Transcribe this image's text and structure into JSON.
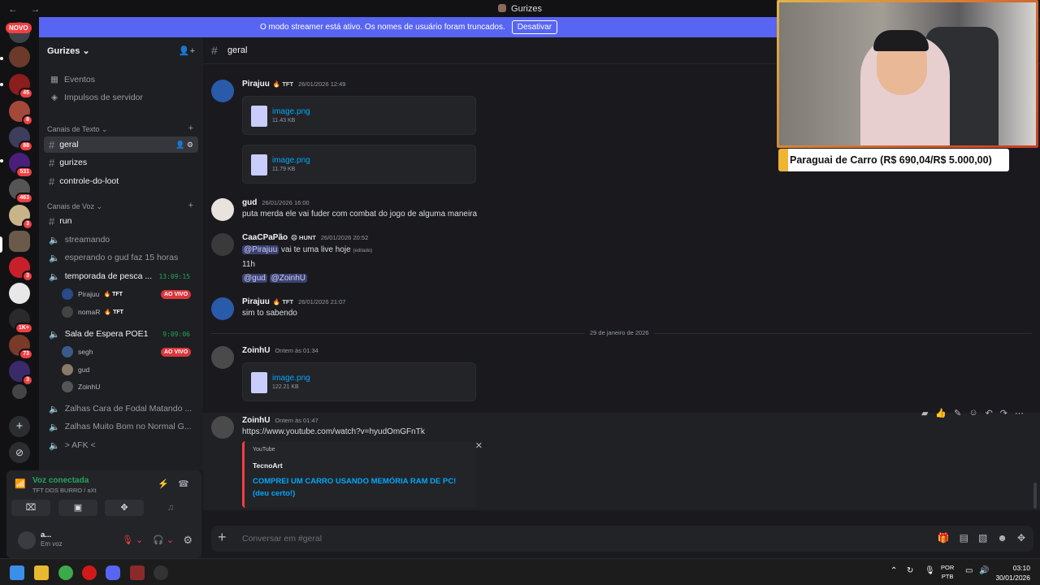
{
  "window": {
    "title": "Gurizes",
    "nav": "← →"
  },
  "banner": {
    "text": "O modo streamer está ativo. Os nomes de usuário foram truncados.",
    "button": "Desativar"
  },
  "servers": {
    "novo": "NOVO",
    "badges": [
      "45",
      "8",
      "88",
      "531",
      "463",
      "3",
      "3",
      "1K+",
      "73",
      "3"
    ],
    "add_icon": "+",
    "explore_icon": "⊘"
  },
  "sidebar": {
    "guild_name": "Gurizes ⌄",
    "items": [
      {
        "label": "Eventos",
        "icon": "calendar-icon"
      },
      {
        "label": "Impulsos de servidor",
        "icon": "boost-icon"
      }
    ],
    "text_category": "Canais de Texto ⌄",
    "text_channels": [
      "geral",
      "gurizes",
      "controle-do-loot"
    ],
    "voice_category": "Canais de Voz ⌄",
    "voice_channels": {
      "run": "run",
      "streamando": "streamando",
      "esperando": "esperando o gud faz 15 horas",
      "temporada": {
        "name": "temporada de pesca ...",
        "timer": "13:09:15"
      },
      "temporada_users": [
        {
          "name": "Pirajuu",
          "tag": "🔥 TFT",
          "live": "AO VIVO"
        },
        {
          "name": "nomaR",
          "tag": "🔥 TFT"
        }
      ],
      "sala": {
        "name": "Sala de Espera POE1",
        "timer": "9:09:06"
      },
      "sala_users": [
        {
          "name": "segh",
          "live": "AO VIVO"
        },
        {
          "name": "gud"
        },
        {
          "name": "ZoinhU"
        }
      ],
      "zalhas1": "Zalhas Cara de Fodal Matando ...",
      "zalhas2": "Zalhas Muito Bom no Normal G...",
      "afk": "> AFK <"
    }
  },
  "voice_panel": {
    "title": "Voz conectada",
    "subtitle": "TFT DOS BURRO / aXt",
    "user_name": "a...",
    "user_status": "Em voz"
  },
  "channel": {
    "name": "geral"
  },
  "messages": {
    "m1": {
      "author": "Pirajuu",
      "tag": "🔥 TFT",
      "time": "26/01/2026 12:49",
      "files": [
        {
          "name": "image.png",
          "size": "11.43 KB"
        },
        {
          "name": "image.png",
          "size": "11.79 KB"
        }
      ]
    },
    "m2": {
      "author": "gud",
      "time": "26/01/2026 16:00",
      "text": "puta merda ele vai fuder com combat do jogo de alguma maneira"
    },
    "m3": {
      "author": "CaaCPaPão",
      "tag": "☹ HUNT",
      "time": "26/01/2026 20:52",
      "mention1": "@Pirajuu",
      "text1": " vai te uma live hoje ",
      "edited": "(editado)",
      "text2": "11h",
      "mention2": "@gud",
      "mention3": "@ZoinhU"
    },
    "m4": {
      "author": "Pirajuu",
      "tag": "🔥 TFT",
      "time": "26/01/2026 21:07",
      "text": "sim to sabendo"
    },
    "divider": "29 de janeiro de 2026",
    "m5": {
      "author": "ZoinhU",
      "time": "Ontem às 01:34",
      "file": {
        "name": "image.png",
        "size": "122.21 KB"
      }
    },
    "m6": {
      "author": "ZoinhU",
      "time": "Ontem às 01:47",
      "link": "https://www.youtube.com/watch?v=hyudOmGFnTk",
      "embed": {
        "provider": "YouTube",
        "author": "TecnoArt",
        "title": "COMPREI UM CARRO USANDO MEMÓRIA RAM DE PC! (deu certo!)"
      }
    }
  },
  "composer": {
    "placeholder": "Conversar em #geral"
  },
  "overlay": {
    "text": "Paraguai de Carro (R$ 690,04/R$ 5.000,00)"
  },
  "taskbar": {
    "lang1": "POR",
    "lang2": "PTB",
    "time": "03:10",
    "date": "30/01/2026"
  },
  "colors": {
    "accent": "#5865f2",
    "green": "#23a55a",
    "red": "#f23f43",
    "link": "#00a8fc"
  }
}
